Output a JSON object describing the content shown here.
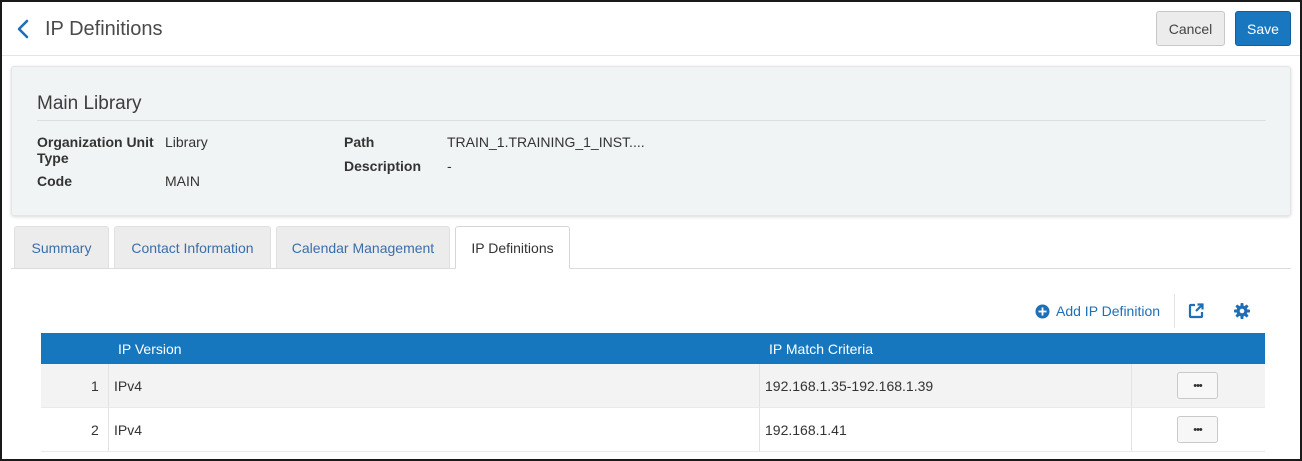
{
  "header": {
    "title": "IP Definitions",
    "cancel_label": "Cancel",
    "save_label": "Save"
  },
  "card": {
    "title": "Main Library",
    "fields": {
      "org_unit_type_label_line1": "Organization Unit",
      "org_unit_type_label_line2": "Type",
      "org_unit_type_value": "Library",
      "code_label": "Code",
      "code_value": "MAIN",
      "path_label": "Path",
      "path_value": "TRAIN_1.TRAINING_1_INST....",
      "description_label": "Description",
      "description_value": "-"
    }
  },
  "tabs": [
    {
      "label": "Summary",
      "active": false
    },
    {
      "label": "Contact Information",
      "active": false
    },
    {
      "label": "Calendar Management",
      "active": false
    },
    {
      "label": "IP Definitions",
      "active": true
    }
  ],
  "toolbar": {
    "add_label": "Add IP Definition",
    "icons": [
      "plus-circle-icon",
      "export-icon",
      "gear-icon"
    ]
  },
  "table": {
    "columns": [
      "IP Version",
      "IP Match Criteria"
    ],
    "rows": [
      {
        "index": "1",
        "ip_version": "IPv4",
        "ip_match": "192.168.1.35-192.168.1.39",
        "actions": "•••"
      },
      {
        "index": "2",
        "ip_version": "IPv4",
        "ip_match": "192.168.1.41",
        "actions": "•••"
      }
    ]
  },
  "colors": {
    "primary": "#1877be",
    "link": "#1e6fb5",
    "tab_text": "#3a6ea8",
    "card_bg": "#f1f4f5"
  }
}
